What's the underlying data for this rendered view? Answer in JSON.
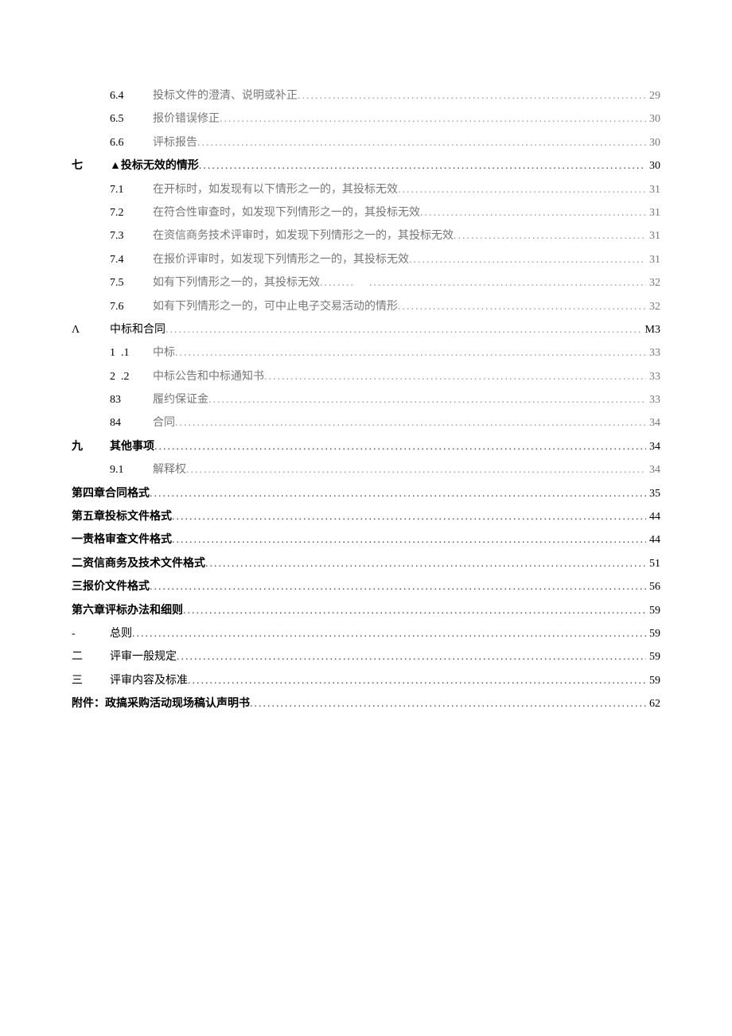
{
  "toc": [
    {
      "type": "l2",
      "num": "6.4",
      "text": "投标文件的澄清、说明或补正",
      "page": "29",
      "light": true
    },
    {
      "type": "l2",
      "num": "6.5",
      "text": "报价错误修正",
      "page": "30",
      "light": true
    },
    {
      "type": "l2",
      "num": "6.6",
      "text": "评标报告",
      "page": "30",
      "light": true
    },
    {
      "type": "l1",
      "section": "七",
      "text": "▲投标无效的情形",
      "page": "30"
    },
    {
      "type": "l2",
      "num": "7.1",
      "text": "在开标时，如发现有以下情形之一的，其投标无效",
      "page": "31",
      "light": true
    },
    {
      "type": "l2",
      "num": "7.2",
      "text": "在符合性审查时，如发现下列情形之一的，其投标无效",
      "page": "31",
      "light": true
    },
    {
      "type": "l2",
      "num": "7.3",
      "text": "在资信商务技术评审时，如发现下列情形之一的，其投标无效",
      "page": "31",
      "light": true
    },
    {
      "type": "l2",
      "num": "7.4",
      "text": "在报价评审时，如发现下列情形之一的，其投标无效",
      "page": "31",
      "light": true
    },
    {
      "type": "l2",
      "num": "7.5",
      "text": "如有下列情形之一的，其投标无效",
      "page": "32",
      "light": true,
      "gap": true
    },
    {
      "type": "l2",
      "num": "7.6",
      "text": "如有下列情形之一的，可中止电子交易活动的情形",
      "page": "32",
      "light": true
    },
    {
      "type": "l1",
      "section": "Λ",
      "text": "中标和合同",
      "page": "M3",
      "normalWeight": true,
      "lightDots": true
    },
    {
      "type": "l2b",
      "num1": "1",
      "num2": ".1",
      "text": "中标",
      "page": "33",
      "light": true
    },
    {
      "type": "l2b",
      "num1": "2",
      "num2": ".2",
      "text": "中标公告和中标通知书",
      "page": "33",
      "light": true
    },
    {
      "type": "l2",
      "num": "83",
      "text": "履约保证金",
      "page": "33",
      "light": true
    },
    {
      "type": "l2",
      "num": "84",
      "text": "合同",
      "page": "34",
      "light": true
    },
    {
      "type": "l1",
      "section": "九",
      "text": "其他事项",
      "page": "34"
    },
    {
      "type": "l2",
      "num": "9.1",
      "text": "解释权",
      "page": "34",
      "light": true
    },
    {
      "type": "ch",
      "text": "第四章合同格式",
      "page": "35"
    },
    {
      "type": "ch",
      "text": "第五章投标文件格式",
      "page": "44"
    },
    {
      "type": "ch",
      "text": "一责格审查文件格式",
      "page": "44"
    },
    {
      "type": "ch",
      "text": "二资信商务及技术文件格式",
      "page": "51"
    },
    {
      "type": "ch",
      "text": "三报价文件格式",
      "page": "56"
    },
    {
      "type": "ch",
      "text": "第六章评标办法和细则",
      "page": "59"
    },
    {
      "type": "l1p",
      "section": "-",
      "text": "总则",
      "page": "59"
    },
    {
      "type": "l1p",
      "section": "二",
      "text": "评审一般规定",
      "page": "59"
    },
    {
      "type": "l1p",
      "section": "三",
      "text": "评审内容及标准",
      "page": "59"
    },
    {
      "type": "ch",
      "text": "附件：政搞采购活动现场稿认声明书",
      "page": "62"
    }
  ],
  "dotstr": "...............................................................................................................................",
  "dotstr2": ". . . . . . . . . . . . . . . . . . . . . . . . . . . . . . . . . . . . . . . . . . . . . . . . . . . . . . . . . . ."
}
